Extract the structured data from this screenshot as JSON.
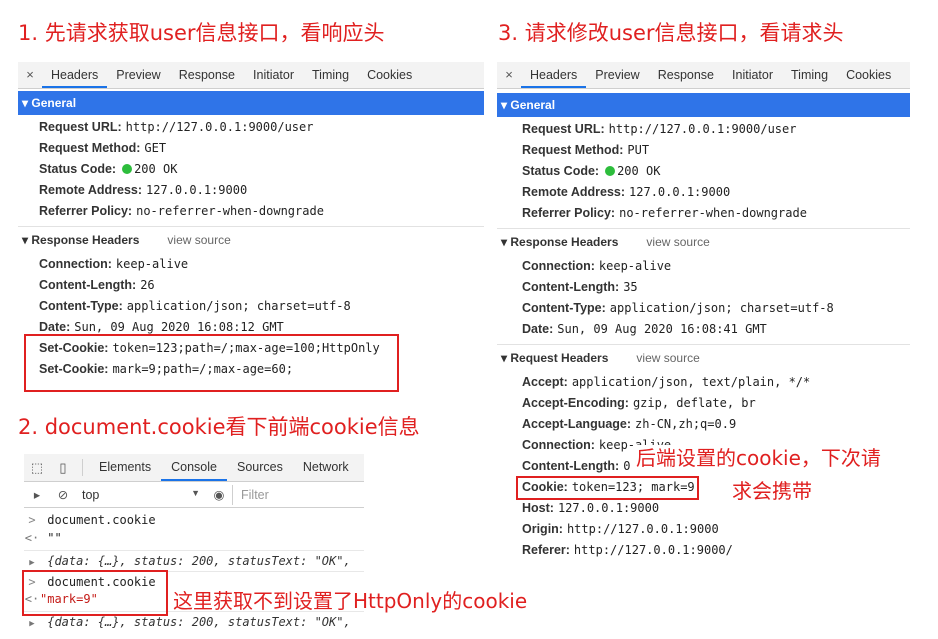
{
  "headings": {
    "h1": "1. 先请求获取user信息接口，看响应头",
    "h2": "2. document.cookie看下前端cookie信息",
    "h3": "3. 请求修改user信息接口，看请求头"
  },
  "notes": {
    "backend": "后端设置的cookie，下次请",
    "backend2": "求会携带",
    "httponly": "这里获取不到设置了HttpOnly的cookie"
  },
  "tabs": [
    "Headers",
    "Preview",
    "Response",
    "Initiator",
    "Timing",
    "Cookies"
  ],
  "close_icon": "×",
  "panel1": {
    "general_title": "▾ General",
    "general": [
      {
        "k": "Request URL:",
        "v": "http://127.0.0.1:9000/user"
      },
      {
        "k": "Request Method:",
        "v": "GET"
      },
      {
        "k": "Status Code:",
        "v": "200 OK"
      },
      {
        "k": "Remote Address:",
        "v": "127.0.0.1:9000"
      },
      {
        "k": "Referrer Policy:",
        "v": "no-referrer-when-downgrade"
      }
    ],
    "resp_title": "▾ Response Headers",
    "view_source": "view source",
    "response": [
      {
        "k": "Connection:",
        "v": "keep-alive"
      },
      {
        "k": "Content-Length:",
        "v": "26"
      },
      {
        "k": "Content-Type:",
        "v": "application/json; charset=utf-8"
      },
      {
        "k": "Date:",
        "v": "Sun, 09 Aug 2020 16:08:12 GMT"
      },
      {
        "k": "Set-Cookie:",
        "v": "token=123;path=/;max-age=100;HttpOnly"
      },
      {
        "k": "Set-Cookie:",
        "v": "mark=9;path=/;max-age=60;"
      }
    ]
  },
  "panel3": {
    "general_title": "▾ General",
    "general": [
      {
        "k": "Request URL:",
        "v": "http://127.0.0.1:9000/user"
      },
      {
        "k": "Request Method:",
        "v": "PUT"
      },
      {
        "k": "Status Code:",
        "v": "200 OK"
      },
      {
        "k": "Remote Address:",
        "v": "127.0.0.1:9000"
      },
      {
        "k": "Referrer Policy:",
        "v": "no-referrer-when-downgrade"
      }
    ],
    "resp_title": "▾ Response Headers",
    "view_source": "view source",
    "response": [
      {
        "k": "Connection:",
        "v": "keep-alive"
      },
      {
        "k": "Content-Length:",
        "v": "35"
      },
      {
        "k": "Content-Type:",
        "v": "application/json; charset=utf-8"
      },
      {
        "k": "Date:",
        "v": "Sun, 09 Aug 2020 16:08:41 GMT"
      }
    ],
    "req_title": "▾ Request Headers",
    "request": [
      {
        "k": "Accept:",
        "v": "application/json, text/plain, */*"
      },
      {
        "k": "Accept-Encoding:",
        "v": "gzip, deflate, br"
      },
      {
        "k": "Accept-Language:",
        "v": "zh-CN,zh;q=0.9"
      },
      {
        "k": "Connection:",
        "v": "keep-alive"
      },
      {
        "k": "Content-Length:",
        "v": "0"
      },
      {
        "k": "Cookie:",
        "v": "token=123; mark=9"
      },
      {
        "k": "Host:",
        "v": "127.0.0.1:9000"
      },
      {
        "k": "Origin:",
        "v": "http://127.0.0.1:9000"
      },
      {
        "k": "Referer:",
        "v": "http://127.0.0.1:9000/"
      }
    ]
  },
  "console": {
    "tabs": [
      "Elements",
      "Console",
      "Sources",
      "Network"
    ],
    "context": "top",
    "context_arrow": "▼",
    "filter_placeholder": "Filter",
    "lines": {
      "l1_prompt": ">",
      "l1": "document.cookie",
      "l2_prompt": "<·",
      "l2": "\"\"",
      "l3_arrow": "▶",
      "l3_a": "{data: {…}, status: ",
      "l3_num": "200",
      "l3_b": ", statusText: ",
      "l3_str": "\"OK\"",
      "l3_c": ",",
      "l4_prompt": ">",
      "l4": "document.cookie",
      "l5_prompt": "<·",
      "l5": "\"mark=9\"",
      "l6_arrow": "▶",
      "l6_a": "{data: {…}, status: ",
      "l6_num": "200",
      "l6_b": ", statusText: ",
      "l6_str": "\"OK\"",
      "l6_c": ","
    }
  },
  "colors": {
    "accent": "#2f74e8",
    "annotation": "#e02020",
    "status_ok": "#2dbd3c"
  }
}
